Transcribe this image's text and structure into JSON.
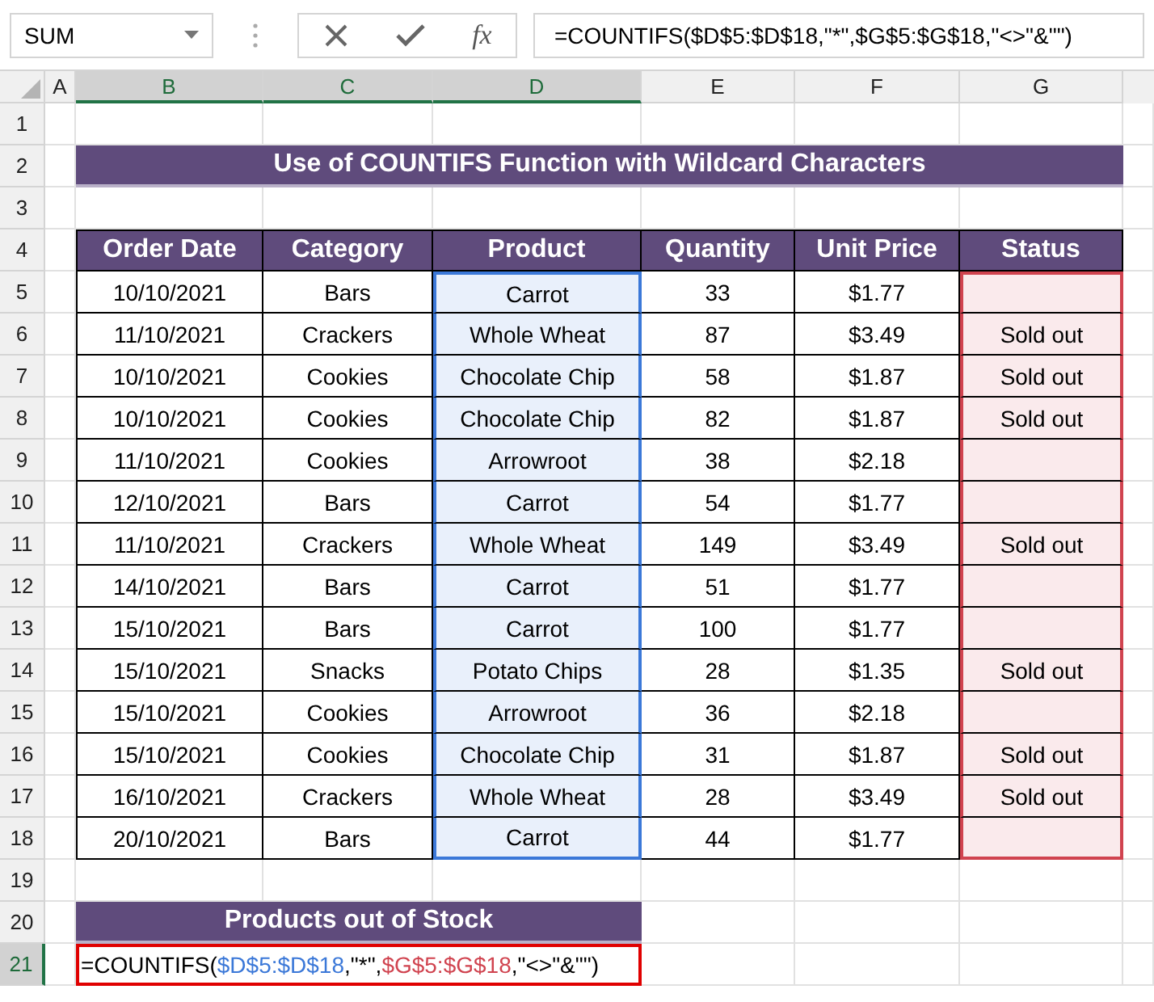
{
  "name_box": "SUM",
  "formula_bar": {
    "function_label": "fx",
    "text": "=COUNTIFS($D$5:$D$18,\"*\",$G$5:$G$18,\"<>\"&\"\")"
  },
  "column_headers": [
    {
      "label": "A",
      "selected": false
    },
    {
      "label": "B",
      "selected": true
    },
    {
      "label": "C",
      "selected": true
    },
    {
      "label": "D",
      "selected": true
    },
    {
      "label": "E",
      "selected": false
    },
    {
      "label": "F",
      "selected": false
    },
    {
      "label": "G",
      "selected": false
    }
  ],
  "row_headers": [
    {
      "label": "1",
      "selected": false
    },
    {
      "label": "2",
      "selected": false
    },
    {
      "label": "3",
      "selected": false
    },
    {
      "label": "4",
      "selected": false
    },
    {
      "label": "5",
      "selected": false
    },
    {
      "label": "6",
      "selected": false
    },
    {
      "label": "7",
      "selected": false
    },
    {
      "label": "8",
      "selected": false
    },
    {
      "label": "9",
      "selected": false
    },
    {
      "label": "10",
      "selected": false
    },
    {
      "label": "11",
      "selected": false
    },
    {
      "label": "12",
      "selected": false
    },
    {
      "label": "13",
      "selected": false
    },
    {
      "label": "14",
      "selected": false
    },
    {
      "label": "15",
      "selected": false
    },
    {
      "label": "16",
      "selected": false
    },
    {
      "label": "17",
      "selected": false
    },
    {
      "label": "18",
      "selected": false
    },
    {
      "label": "19",
      "selected": false
    },
    {
      "label": "20",
      "selected": false
    },
    {
      "label": "21",
      "selected": true
    }
  ],
  "title": "Use of COUNTIFS Function with Wildcard Characters",
  "table": {
    "columns": [
      {
        "label": "Order Date"
      },
      {
        "label": "Category"
      },
      {
        "label": "Product",
        "color": "#3b78d8"
      },
      {
        "label": "Quantity"
      },
      {
        "label": "Unit Price"
      },
      {
        "label": "Status",
        "color": "#d0434f"
      }
    ],
    "rows": [
      [
        "10/10/2021",
        "Bars",
        "Carrot",
        "33",
        "$1.77"
      ],
      [
        "11/10/2021",
        "Crackers",
        "Whole Wheat",
        "87",
        "$3.49",
        "Sold out"
      ],
      [
        "10/10/2021",
        "Cookies",
        "Chocolate Chip",
        "58",
        "$1.87",
        "Sold out"
      ],
      [
        "10/10/2021",
        "Cookies",
        "Chocolate Chip",
        "82",
        "$1.87",
        "Sold out"
      ],
      [
        "11/10/2021",
        "Cookies",
        "Arrowroot",
        "38",
        "$2.18"
      ],
      [
        "12/10/2021",
        "Bars",
        "Carrot",
        "54",
        "$1.77"
      ],
      [
        "11/10/2021",
        "Crackers",
        "Whole Wheat",
        "149",
        "$3.49",
        "Sold out"
      ],
      [
        "14/10/2021",
        "Bars",
        "Carrot",
        "51",
        "$1.77"
      ],
      [
        "15/10/2021",
        "Bars",
        "Carrot",
        "100",
        "$1.77"
      ],
      [
        "15/10/2021",
        "Snacks",
        "Potato Chips",
        "28",
        "$1.35",
        "Sold out"
      ],
      [
        "15/10/2021",
        "Cookies",
        "Arrowroot",
        "36",
        "$2.18"
      ],
      [
        "15/10/2021",
        "Cookies",
        "Chocolate Chip",
        "31",
        "$1.87",
        "Sold out"
      ],
      [
        "16/10/2021",
        "Crackers",
        "Whole Wheat",
        "28",
        "$3.49",
        "Sold out"
      ],
      [
        "20/10/2021",
        "Bars",
        "Carrot",
        "44",
        "$1.77"
      ]
    ]
  },
  "summary": {
    "title": "Products out of Stock",
    "formula_segments": [
      {
        "text": "=COUNTIFS(",
        "color": "#000000"
      },
      {
        "text": "$D$5:$D$18",
        "color": "#3b78d8"
      },
      {
        "text": ",\"*\",",
        "color": "#000000"
      },
      {
        "text": "$G$5:$G$18",
        "color": "#d0434f"
      },
      {
        "text": ",\"<>\"&\"\")",
        "color": "#000000"
      }
    ]
  }
}
